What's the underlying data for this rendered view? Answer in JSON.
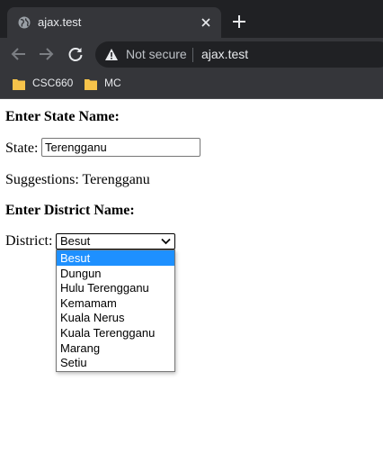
{
  "browser": {
    "tab_title": "ajax.test",
    "security_label": "Not secure",
    "url": "ajax.test",
    "bookmarks": [
      {
        "label": "CSC660",
        "icon": "folder-icon"
      },
      {
        "label": "MC",
        "icon": "folder-icon"
      }
    ]
  },
  "page": {
    "state_heading": "Enter State Name:",
    "state_label": "State:",
    "state_value": "Terengganu",
    "suggestions_label": "Suggestions:",
    "suggestions_value": "Terengganu",
    "district_heading": "Enter District Name:",
    "district_label": "District:",
    "district_selected": "Besut",
    "district_options": [
      "Besut",
      "Dungun",
      "Hulu Terengganu",
      "Kemamam",
      "Kuala Nerus",
      "Kuala Terengganu",
      "Marang",
      "Setiu"
    ]
  },
  "colors": {
    "chrome_dark": "#202124",
    "chrome_toolbar": "#35363a",
    "selection": "#1e90ff",
    "folder": "#f6c34a"
  }
}
